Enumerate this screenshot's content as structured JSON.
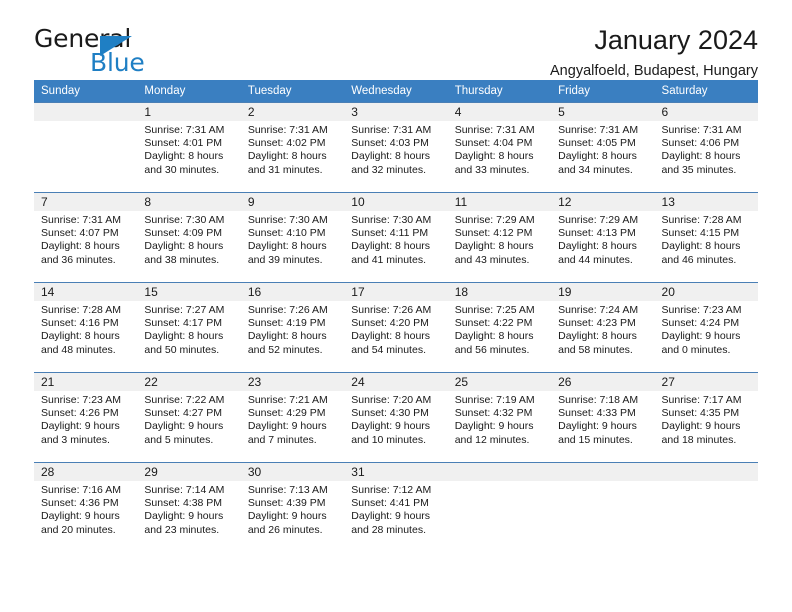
{
  "brand": {
    "name_top": "General",
    "name_bottom": "Blue",
    "accent_color": "#1f7fc4"
  },
  "header": {
    "title": "January 2024",
    "subtitle": "Angyalfoeld, Budapest, Hungary"
  },
  "theme": {
    "header_row_bg": "#3a7fc1",
    "header_row_text": "#ffffff",
    "daynum_bg": "#f0f0f0",
    "cell_border": "#4a7fb5",
    "page_bg": "#ffffff",
    "text": "#1a1a1a"
  },
  "weekday_headers": [
    "Sunday",
    "Monday",
    "Tuesday",
    "Wednesday",
    "Thursday",
    "Friday",
    "Saturday"
  ],
  "labels": {
    "sunrise_prefix": "Sunrise:",
    "sunset_prefix": "Sunset:",
    "daylight_prefix": "Daylight:"
  },
  "weeks": [
    [
      {
        "day": "",
        "line1": "",
        "line2": "",
        "line3": "",
        "line4": ""
      },
      {
        "day": "1",
        "line1": "Sunrise: 7:31 AM",
        "line2": "Sunset: 4:01 PM",
        "line3": "Daylight: 8 hours",
        "line4": "and 30 minutes."
      },
      {
        "day": "2",
        "line1": "Sunrise: 7:31 AM",
        "line2": "Sunset: 4:02 PM",
        "line3": "Daylight: 8 hours",
        "line4": "and 31 minutes."
      },
      {
        "day": "3",
        "line1": "Sunrise: 7:31 AM",
        "line2": "Sunset: 4:03 PM",
        "line3": "Daylight: 8 hours",
        "line4": "and 32 minutes."
      },
      {
        "day": "4",
        "line1": "Sunrise: 7:31 AM",
        "line2": "Sunset: 4:04 PM",
        "line3": "Daylight: 8 hours",
        "line4": "and 33 minutes."
      },
      {
        "day": "5",
        "line1": "Sunrise: 7:31 AM",
        "line2": "Sunset: 4:05 PM",
        "line3": "Daylight: 8 hours",
        "line4": "and 34 minutes."
      },
      {
        "day": "6",
        "line1": "Sunrise: 7:31 AM",
        "line2": "Sunset: 4:06 PM",
        "line3": "Daylight: 8 hours",
        "line4": "and 35 minutes."
      }
    ],
    [
      {
        "day": "7",
        "line1": "Sunrise: 7:31 AM",
        "line2": "Sunset: 4:07 PM",
        "line3": "Daylight: 8 hours",
        "line4": "and 36 minutes."
      },
      {
        "day": "8",
        "line1": "Sunrise: 7:30 AM",
        "line2": "Sunset: 4:09 PM",
        "line3": "Daylight: 8 hours",
        "line4": "and 38 minutes."
      },
      {
        "day": "9",
        "line1": "Sunrise: 7:30 AM",
        "line2": "Sunset: 4:10 PM",
        "line3": "Daylight: 8 hours",
        "line4": "and 39 minutes."
      },
      {
        "day": "10",
        "line1": "Sunrise: 7:30 AM",
        "line2": "Sunset: 4:11 PM",
        "line3": "Daylight: 8 hours",
        "line4": "and 41 minutes."
      },
      {
        "day": "11",
        "line1": "Sunrise: 7:29 AM",
        "line2": "Sunset: 4:12 PM",
        "line3": "Daylight: 8 hours",
        "line4": "and 43 minutes."
      },
      {
        "day": "12",
        "line1": "Sunrise: 7:29 AM",
        "line2": "Sunset: 4:13 PM",
        "line3": "Daylight: 8 hours",
        "line4": "and 44 minutes."
      },
      {
        "day": "13",
        "line1": "Sunrise: 7:28 AM",
        "line2": "Sunset: 4:15 PM",
        "line3": "Daylight: 8 hours",
        "line4": "and 46 minutes."
      }
    ],
    [
      {
        "day": "14",
        "line1": "Sunrise: 7:28 AM",
        "line2": "Sunset: 4:16 PM",
        "line3": "Daylight: 8 hours",
        "line4": "and 48 minutes."
      },
      {
        "day": "15",
        "line1": "Sunrise: 7:27 AM",
        "line2": "Sunset: 4:17 PM",
        "line3": "Daylight: 8 hours",
        "line4": "and 50 minutes."
      },
      {
        "day": "16",
        "line1": "Sunrise: 7:26 AM",
        "line2": "Sunset: 4:19 PM",
        "line3": "Daylight: 8 hours",
        "line4": "and 52 minutes."
      },
      {
        "day": "17",
        "line1": "Sunrise: 7:26 AM",
        "line2": "Sunset: 4:20 PM",
        "line3": "Daylight: 8 hours",
        "line4": "and 54 minutes."
      },
      {
        "day": "18",
        "line1": "Sunrise: 7:25 AM",
        "line2": "Sunset: 4:22 PM",
        "line3": "Daylight: 8 hours",
        "line4": "and 56 minutes."
      },
      {
        "day": "19",
        "line1": "Sunrise: 7:24 AM",
        "line2": "Sunset: 4:23 PM",
        "line3": "Daylight: 8 hours",
        "line4": "and 58 minutes."
      },
      {
        "day": "20",
        "line1": "Sunrise: 7:23 AM",
        "line2": "Sunset: 4:24 PM",
        "line3": "Daylight: 9 hours",
        "line4": "and 0 minutes."
      }
    ],
    [
      {
        "day": "21",
        "line1": "Sunrise: 7:23 AM",
        "line2": "Sunset: 4:26 PM",
        "line3": "Daylight: 9 hours",
        "line4": "and 3 minutes."
      },
      {
        "day": "22",
        "line1": "Sunrise: 7:22 AM",
        "line2": "Sunset: 4:27 PM",
        "line3": "Daylight: 9 hours",
        "line4": "and 5 minutes."
      },
      {
        "day": "23",
        "line1": "Sunrise: 7:21 AM",
        "line2": "Sunset: 4:29 PM",
        "line3": "Daylight: 9 hours",
        "line4": "and 7 minutes."
      },
      {
        "day": "24",
        "line1": "Sunrise: 7:20 AM",
        "line2": "Sunset: 4:30 PM",
        "line3": "Daylight: 9 hours",
        "line4": "and 10 minutes."
      },
      {
        "day": "25",
        "line1": "Sunrise: 7:19 AM",
        "line2": "Sunset: 4:32 PM",
        "line3": "Daylight: 9 hours",
        "line4": "and 12 minutes."
      },
      {
        "day": "26",
        "line1": "Sunrise: 7:18 AM",
        "line2": "Sunset: 4:33 PM",
        "line3": "Daylight: 9 hours",
        "line4": "and 15 minutes."
      },
      {
        "day": "27",
        "line1": "Sunrise: 7:17 AM",
        "line2": "Sunset: 4:35 PM",
        "line3": "Daylight: 9 hours",
        "line4": "and 18 minutes."
      }
    ],
    [
      {
        "day": "28",
        "line1": "Sunrise: 7:16 AM",
        "line2": "Sunset: 4:36 PM",
        "line3": "Daylight: 9 hours",
        "line4": "and 20 minutes."
      },
      {
        "day": "29",
        "line1": "Sunrise: 7:14 AM",
        "line2": "Sunset: 4:38 PM",
        "line3": "Daylight: 9 hours",
        "line4": "and 23 minutes."
      },
      {
        "day": "30",
        "line1": "Sunrise: 7:13 AM",
        "line2": "Sunset: 4:39 PM",
        "line3": "Daylight: 9 hours",
        "line4": "and 26 minutes."
      },
      {
        "day": "31",
        "line1": "Sunrise: 7:12 AM",
        "line2": "Sunset: 4:41 PM",
        "line3": "Daylight: 9 hours",
        "line4": "and 28 minutes."
      },
      {
        "day": "",
        "line1": "",
        "line2": "",
        "line3": "",
        "line4": ""
      },
      {
        "day": "",
        "line1": "",
        "line2": "",
        "line3": "",
        "line4": ""
      },
      {
        "day": "",
        "line1": "",
        "line2": "",
        "line3": "",
        "line4": ""
      }
    ]
  ]
}
